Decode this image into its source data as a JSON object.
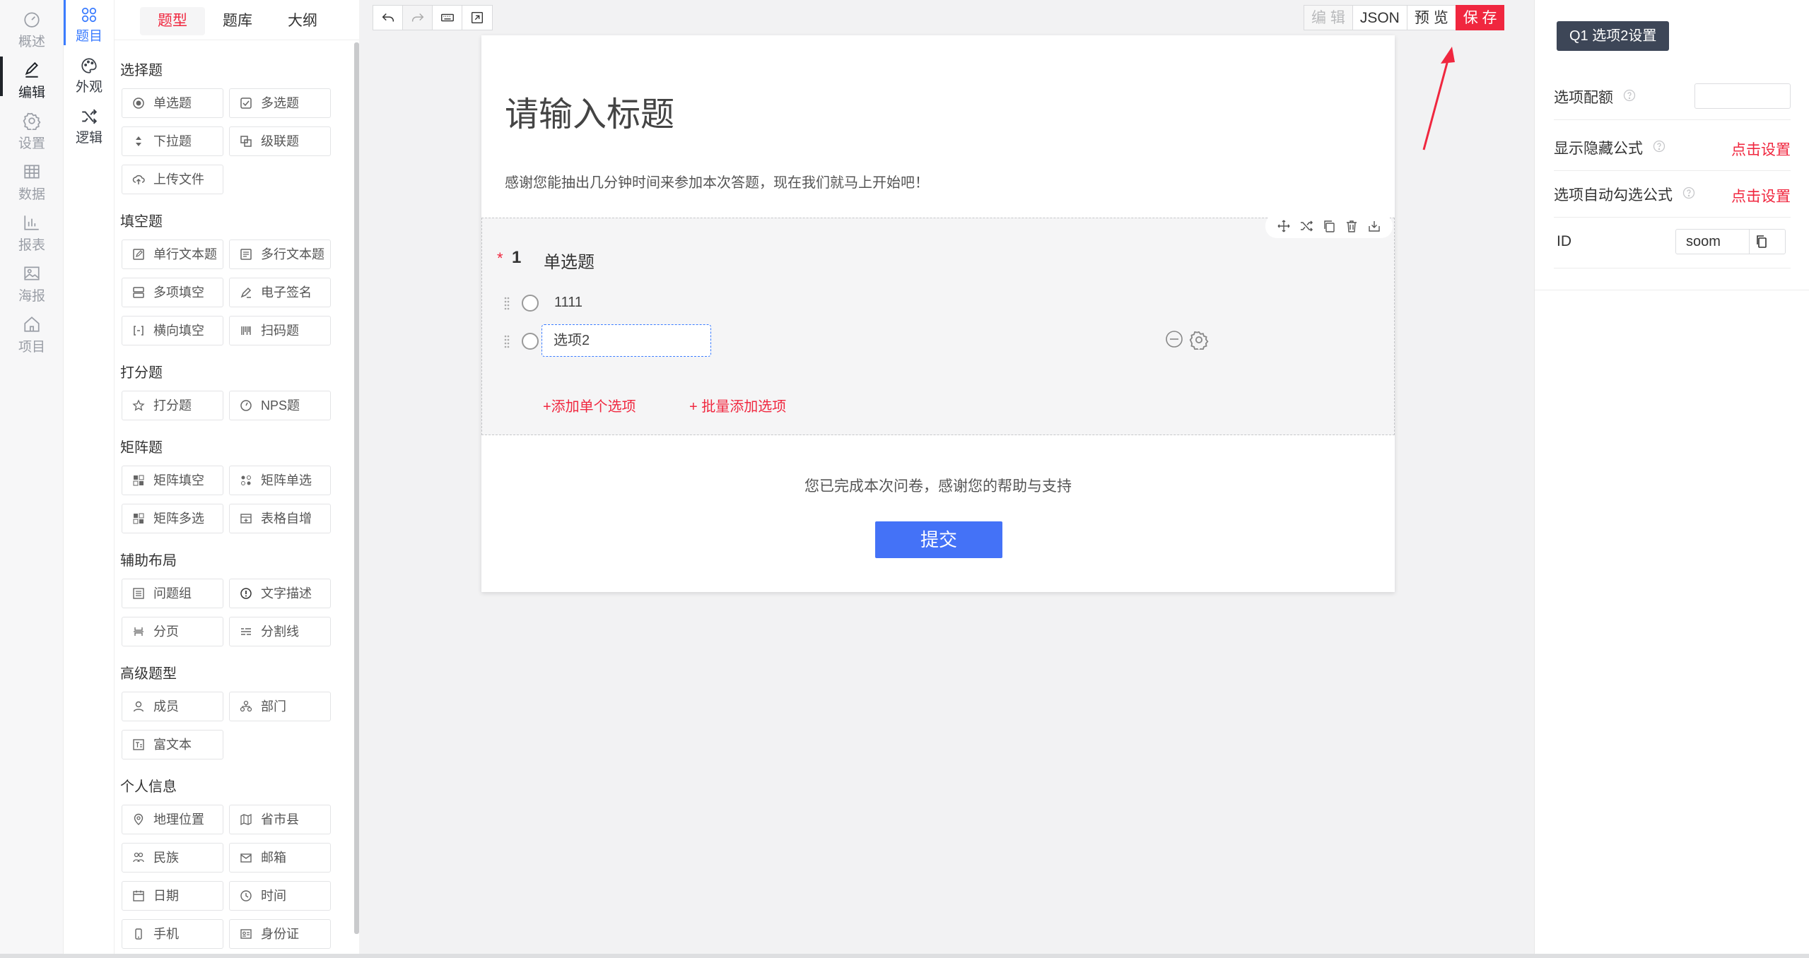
{
  "rail": {
    "items": [
      {
        "label": "概述",
        "icon": "dashboard-icon"
      },
      {
        "label": "编辑",
        "icon": "pen-icon"
      },
      {
        "label": "设置",
        "icon": "gear-icon"
      },
      {
        "label": "数据",
        "icon": "table-icon"
      },
      {
        "label": "报表",
        "icon": "bar-chart-icon"
      },
      {
        "label": "海报",
        "icon": "image-icon"
      },
      {
        "label": "项目",
        "icon": "home-icon"
      }
    ]
  },
  "subrail": {
    "items": [
      {
        "label": "题目",
        "icon": "question-grid-icon"
      },
      {
        "label": "外观",
        "icon": "palette-icon"
      },
      {
        "label": "逻辑",
        "icon": "shuffle-icon"
      }
    ]
  },
  "palette": {
    "tabs": [
      "题型",
      "题库",
      "大纲"
    ],
    "sections": [
      {
        "title": "选择题",
        "items": [
          "单选题",
          "多选题",
          "下拉题",
          "级联题",
          "上传文件"
        ]
      },
      {
        "title": "填空题",
        "items": [
          "单行文本题",
          "多行文本题",
          "多项填空",
          "电子签名",
          "横向填空",
          "扫码题"
        ]
      },
      {
        "title": "打分题",
        "items": [
          "打分题",
          "NPS题"
        ]
      },
      {
        "title": "矩阵题",
        "items": [
          "矩阵填空",
          "矩阵单选",
          "矩阵多选",
          "表格自增"
        ]
      },
      {
        "title": "辅助布局",
        "items": [
          "问题组",
          "文字描述",
          "分页",
          "分割线"
        ]
      },
      {
        "title": "高级题型",
        "items": [
          "成员",
          "部门",
          "富文本"
        ]
      },
      {
        "title": "个人信息",
        "items": [
          "地理位置",
          "省市县",
          "民族",
          "邮箱",
          "日期",
          "时间",
          "手机",
          "身份证"
        ]
      }
    ]
  },
  "toolbar": {
    "left_icons": [
      "undo-icon",
      "redo-icon",
      "keyboard-icon",
      "export-icon"
    ],
    "edit": "编 辑",
    "json": "JSON",
    "preview": "预 览",
    "save": "保 存"
  },
  "survey": {
    "title": "请输入标题",
    "intro": "感谢您能抽出几分钟时间来参加本次答题，现在我们就马上开始吧！",
    "question": {
      "required_mark": "*",
      "number": "1",
      "title": "单选题",
      "options": [
        "1111",
        "选项2"
      ],
      "add_single": "+添加单个选项",
      "add_batch": "+ 批量添加选项"
    },
    "finish": "您已完成本次问卷，感谢您的帮助与支持",
    "submit": "提交"
  },
  "settings": {
    "title": "Q1 选项2设置",
    "quota_label": "选项配额",
    "quota_value": "",
    "show_hide_label": "显示隐藏公式",
    "show_hide_link": "点击设置",
    "auto_check_label": "选项自动勾选公式",
    "auto_check_link": "点击设置",
    "id_label": "ID",
    "id_value": "soom"
  },
  "colors": {
    "accent": "#f0273f",
    "primary": "#4472f7",
    "active_blue": "#3b7cff"
  }
}
